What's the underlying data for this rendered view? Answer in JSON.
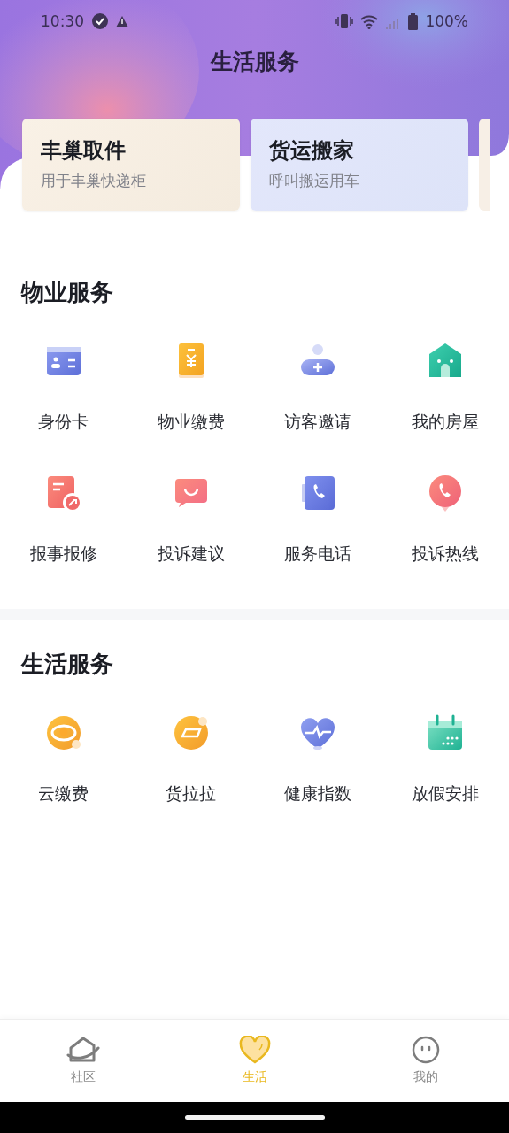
{
  "status_bar": {
    "time": "10:30",
    "battery": "100%"
  },
  "header": {
    "title": "生活服务"
  },
  "cards": [
    {
      "title": "丰巢取件",
      "subtitle": "用于丰巢快递柜"
    },
    {
      "title": "货运搬家",
      "subtitle": "呼叫搬运用车"
    }
  ],
  "sections": [
    {
      "title": "物业服务",
      "items": [
        {
          "label": "身份卡"
        },
        {
          "label": "物业缴费"
        },
        {
          "label": "访客邀请"
        },
        {
          "label": "我的房屋"
        },
        {
          "label": "报事报修"
        },
        {
          "label": "投诉建议"
        },
        {
          "label": "服务电话"
        },
        {
          "label": "投诉热线"
        }
      ]
    },
    {
      "title": "生活服务",
      "items": [
        {
          "label": "云缴费"
        },
        {
          "label": "货拉拉"
        },
        {
          "label": "健康指数"
        },
        {
          "label": "放假安排"
        }
      ]
    }
  ],
  "tab_bar": [
    {
      "label": "社区",
      "selected": false
    },
    {
      "label": "生活",
      "selected": true
    },
    {
      "label": "我的",
      "selected": false
    }
  ]
}
